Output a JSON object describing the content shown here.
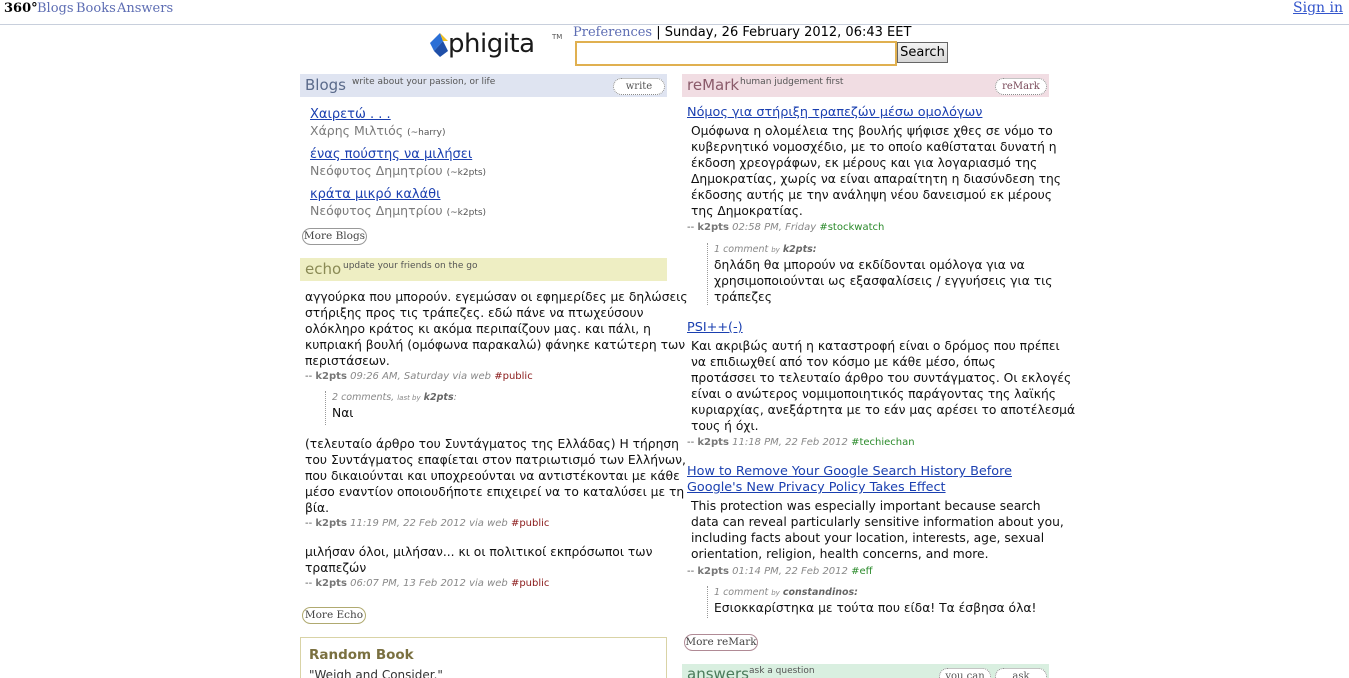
{
  "topbar": {
    "brand": "360°",
    "nav": [
      "Blogs",
      "Books",
      "Answers"
    ],
    "signin": "Sign in"
  },
  "header": {
    "logo_text": "phigita",
    "logo_tm": "TM",
    "preferences": "Preferences",
    "separator": "|",
    "date": "Sunday, 26 February 2012, 06:43 EET",
    "search_value": "",
    "search_button": "Search"
  },
  "blogs": {
    "title": "Blogs",
    "tagline": "write about your passion, or life",
    "action": "write",
    "more": "More Blogs",
    "items": [
      {
        "title": "Χαιρετώ . . .",
        "author": "Χάρης Μιλτιός",
        "handle": "(~harry)"
      },
      {
        "title": "ένας πούστης να μιλήσει",
        "author": "Νεόφυτος Δημητρίου",
        "handle": "(~k2pts)"
      },
      {
        "title": "κράτα μικρό καλάθι",
        "author": "Νεόφυτος Δημητρίου",
        "handle": "(~k2pts)"
      }
    ]
  },
  "echo": {
    "title": "echo",
    "tagline": "update your friends on the go",
    "more": "More Echo",
    "posts": [
      {
        "lines": [
          "αγγούρκα που μπορούν. εγεμώσαν οι εφημερίδες με δηλώσεις",
          "στήριξης προς τις τράπεζες. εδώ πάνε να πτωχεύσουν",
          "ολόκληρο κράτος κι ακόμα περιπαίζουν μας. και πάλι, η",
          "κυπριακή βουλή (ομόφωνα παρακαλώ) φάνηκε κατώτερη των",
          "περιστάσεων."
        ],
        "dash": "--",
        "user": "k2pts",
        "time": "09:26 AM, Saturday",
        "via": "via web",
        "hashtag": "#public",
        "comments_head": "2 comments,",
        "comments_last": "last by",
        "comments_user": "k2pts",
        "comment": "Ναι"
      },
      {
        "lines": [
          "(τελευταίο άρθρο του Συντάγματος της Ελλάδας) Η τήρηση",
          "του Συντάγματος επαφίεται στον πατριωτισμό των Ελλήνων,",
          "που δικαιούνται και υποχρεούνται να αντιστέκονται με κάθε",
          "μέσο εναντίον οποιουδήποτε επιχειρεί να το καταλύσει με τη",
          "βία."
        ],
        "dash": "--",
        "user": "k2pts",
        "time": "11:19 PM, 22 Feb 2012",
        "via": "via web",
        "hashtag": "#public"
      },
      {
        "lines": [
          "μιλήσαν όλοι, μιλήσαν... κι οι πολιτικοί εκπρόσωποι των",
          "τραπεζών"
        ],
        "dash": "--",
        "user": "k2pts",
        "time": "06:07 PM, 13 Feb 2012",
        "via": "via web",
        "hashtag": "#public"
      }
    ]
  },
  "book": {
    "title": "Random Book",
    "quote": "\"Weigh and Consider.\""
  },
  "remark": {
    "title": "reMark",
    "tagline": "human judgement first",
    "action": "reMark",
    "more": "More reMark",
    "items": [
      {
        "title_lines": [
          "Νόμος για στήριξη τραπεζών μέσω ομολόγων"
        ],
        "lines": [
          "Ομόφωνα η ολομέλεια της βουλής ψήφισε χθες σε νόμο το",
          "κυβερνητικό νομοσχέδιο, με το οποίο καθίσταται δυνατή η",
          "έκδοση χρεογράφων, εκ μέρους και για λογαριασμό της",
          "Δημοκρατίας, χωρίς να είναι απαραίτητη η διασύνδεση της",
          "έκδοσης αυτής με την ανάληψη νέου δανεισμού εκ μέρους",
          "της Δημοκρατίας."
        ],
        "dash": "--",
        "user": "k2pts",
        "time": "02:58 PM, Friday",
        "hashtag": "#stockwatch",
        "comment_head": "1 comment",
        "comment_by": "by",
        "comment_user": "k2pts:",
        "comment_lines": [
          "δηλάδη θα μπορούν να εκδίδονται ομόλογα για να",
          "χρησιμοποιούνται ως εξασφαλίσεις / εγγυήσεις για τις",
          "τράπεζες"
        ]
      },
      {
        "title_lines": [
          "PSI++(-)"
        ],
        "lines": [
          "Και ακριβώς αυτή η καταστροφή είναι ο δρόμος που πρέπει",
          "να επιδιωχθεί από τον κόσμο με κάθε μέσο, όπως",
          "προτάσσει το τελευταίο άρθρο του συντάγματος. Οι εκλογές",
          "είναι ο ανώτερος νομιμοποιητικός παράγοντας της λαϊκής",
          "κυριαρχίας, ανεξάρτητα με το εάν μας αρέσει το αποτέλεσμά",
          "τους ή όχι."
        ],
        "dash": "--",
        "user": "k2pts",
        "time": "11:18 PM, 22 Feb 2012",
        "hashtag": "#techiechan"
      },
      {
        "title_lines": [
          "How to Remove Your Google Search History Before",
          "Google's New Privacy Policy Takes Effect"
        ],
        "lines": [
          "This protection was especially important because search",
          "data can reveal particularly sensitive information about you,",
          "including facts about your location, interests, age, sexual",
          "orientation, religion, health concerns, and more."
        ],
        "dash": "--",
        "user": "k2pts",
        "time": "01:14 PM, 22 Feb 2012",
        "hashtag": "#eff",
        "comment_head": "1 comment",
        "comment_by": "by",
        "comment_user": "constandinos:",
        "comment_lines": [
          "Εσιοκκαρίστηκα με τούτα που είδα! Τα έσβησα όλα!"
        ]
      }
    ]
  },
  "answers": {
    "title": "answers",
    "tagline": "ask a question",
    "actions": [
      "you can",
      "ask"
    ]
  },
  "colors": {
    "blogs_header": "#dfe4f1",
    "echo_header": "#eeeec3",
    "remark_header": "#f1dde3",
    "answers_header": "#d9efe0",
    "book_border": "#d9d3a6"
  }
}
